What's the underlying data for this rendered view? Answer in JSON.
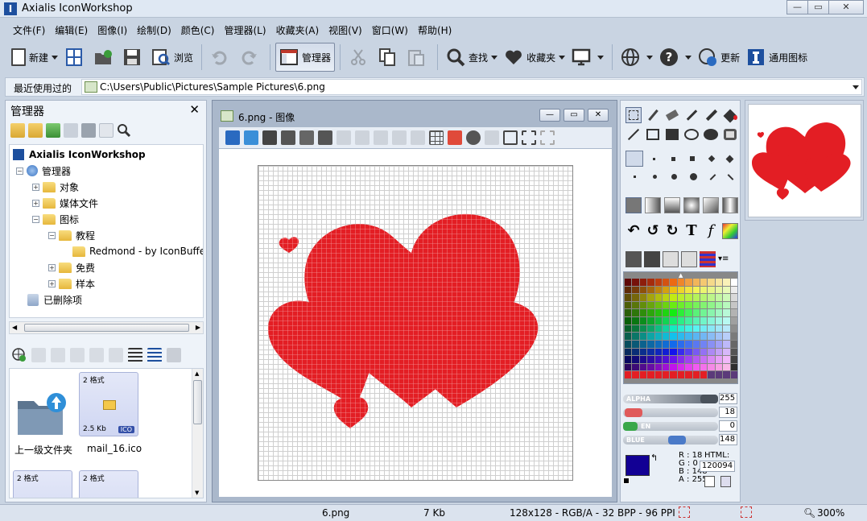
{
  "window": {
    "title": "Axialis IconWorkshop",
    "app_icon_letter": "I"
  },
  "menu": [
    "文件(F)",
    "编辑(E)",
    "图像(I)",
    "绘制(D)",
    "颜色(C)",
    "管理器(L)",
    "收藏夹(A)",
    "视图(V)",
    "窗口(W)",
    "帮助(H)"
  ],
  "toolbar": {
    "new_label": "新建",
    "browse_label": "浏览",
    "manager_label": "管理器",
    "find_label": "查找",
    "favorites_label": "收藏夹",
    "update_label": "更新",
    "universal_label": "通用图标"
  },
  "addressbar": {
    "label": "最近使用过的",
    "path": "C:\\Users\\Public\\Pictures\\Sample Pictures\\6.png"
  },
  "manager_panel": {
    "title": "管理器",
    "close_glyph": "✕",
    "tree": {
      "root": "Axialis IconWorkshop",
      "manager": "管理器",
      "objects": "对象",
      "media": "媒体文件",
      "icons": "图标",
      "tutorial": "教程",
      "redmond": "Redmond - by IconBuffet",
      "free": "免费",
      "sample": "样本",
      "deleted": "已删除项"
    },
    "files": [
      {
        "name": "上一级文件夹"
      },
      {
        "name": "mail_16.ico",
        "formats": "2 格式",
        "size": "2.5 Kb",
        "badge": "ICO"
      },
      {
        "formats": "2 格式"
      },
      {
        "formats": "2 格式"
      }
    ]
  },
  "document": {
    "title": "6.png - 图像"
  },
  "colors": {
    "alpha_label": "ALPHA",
    "alpha": "255",
    "red_label": "",
    "red": "18",
    "green_label": "EN",
    "green": "0",
    "blue_label": "BLUE",
    "blue": "148",
    "rgba_text": {
      "r": "R : 18",
      "g": "G :   0",
      "b": "B : 148",
      "a": "A : 255"
    },
    "html_label": "HTML:",
    "html_value": "120094",
    "current_color": "#120094",
    "heart_red": "#e31e24"
  },
  "status": {
    "filename": "6.png",
    "filesize": "7 Kb",
    "info": "128x128 - RGB/A - 32 BPP - 96 PPI",
    "zoom": "300%"
  }
}
